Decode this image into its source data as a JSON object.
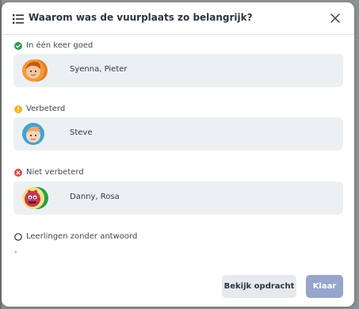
{
  "dialog": {
    "title": "Waarom was de vuurplaats zo belangrijk?",
    "icons": {
      "title": "list-icon",
      "close": "close-icon"
    }
  },
  "sections": [
    {
      "label": "In één keer goed",
      "status": "correct",
      "status_color": "#2e9b4f",
      "students": "Syenna, Pieter"
    },
    {
      "label": "Verbeterd",
      "status": "improved",
      "status_color": "#f3b613",
      "students": "Steve"
    },
    {
      "label": "Niet verbeterd",
      "status": "not-improved",
      "status_color": "#e0463f",
      "students": "Danny, Rosa"
    }
  ],
  "no_answer": {
    "label": "Leerlingen zonder antwoord",
    "value": "-"
  },
  "buttons": {
    "view_assignment": "Bekijk opdracht",
    "done": "Klaar"
  },
  "colors": {
    "primary_button": "#97a5cb",
    "secondary_button": "#e6eaee",
    "row_background": "#edf0f3"
  }
}
